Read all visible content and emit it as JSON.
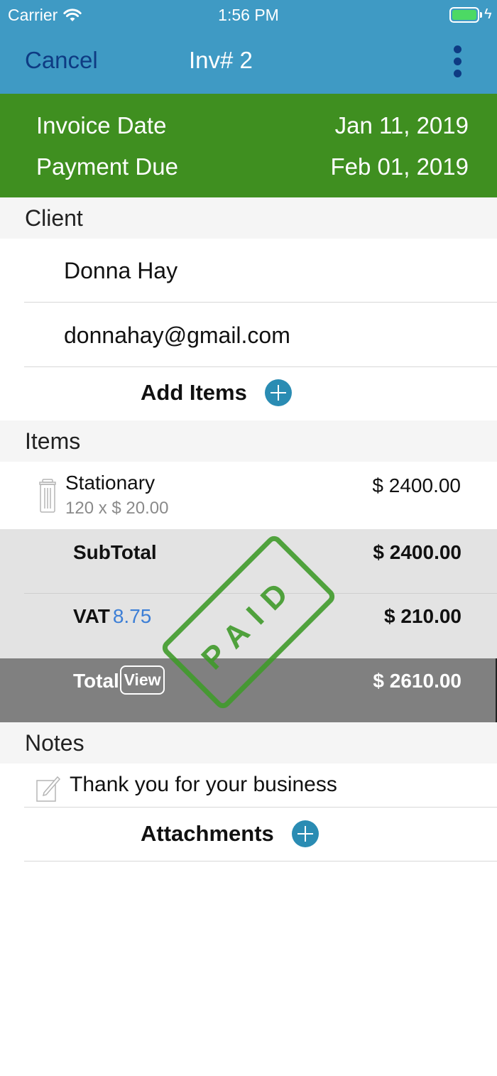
{
  "status_bar": {
    "carrier": "Carrier",
    "time": "1:56 PM",
    "icons": [
      "wifi-icon",
      "battery-icon",
      "charging-bolt-icon"
    ]
  },
  "nav": {
    "cancel_label": "Cancel",
    "title": "Inv# 2",
    "more_icon": "vertical-ellipsis-icon"
  },
  "dates": {
    "invoice_date_label": "Invoice Date",
    "invoice_date_value": "Jan 11, 2019",
    "payment_due_label": "Payment Due",
    "payment_due_value": "Feb 01, 2019"
  },
  "client": {
    "header": "Client",
    "name": "Donna Hay",
    "email": "donnahay@gmail.com",
    "add_items_label": "Add Items"
  },
  "items": {
    "header": "Items",
    "list": [
      {
        "name": "Stationary",
        "detail": "120 x $ 20.00",
        "amount": "$ 2400.00"
      }
    ]
  },
  "totals": {
    "subtotal_label": "SubTotal",
    "subtotal_value": "$ 2400.00",
    "vat_label": "VAT",
    "vat_rate": "8.75",
    "vat_value": "$ 210.00",
    "total_label": "Total",
    "view_label": "View",
    "total_value": "$ 2610.00"
  },
  "stamp": {
    "text": "PAID",
    "color": "#3f9a2a"
  },
  "notes": {
    "header": "Notes",
    "text": "Thank you for your business",
    "attachments_label": "Attachments"
  },
  "colors": {
    "nav_bg": "#3f9ac4",
    "dates_bg": "#3f8f20",
    "accent_button": "#2a8cb3",
    "vat_rate_text": "#3d7fd6"
  }
}
